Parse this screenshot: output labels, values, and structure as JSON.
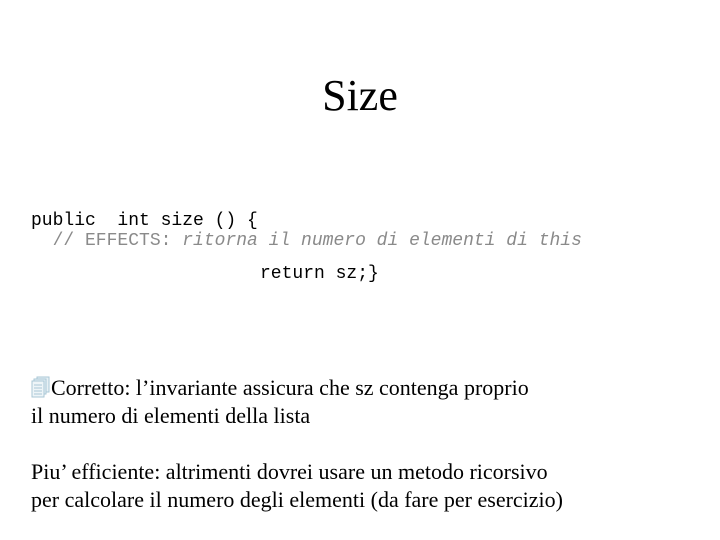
{
  "slide": {
    "title": "Size",
    "code": {
      "line1": "public  int size () {",
      "line2_prefix": "  // EFFECTS: ",
      "line2_italic": "ritorna il numero di elementi di this",
      "line3": "return sz;}"
    },
    "paragraph1": {
      "bullet_icon": "stacked-documents-icon",
      "line1": "Corretto: l’invariante assicura che sz contenga proprio",
      "line2": "il numero di elementi della lista"
    },
    "paragraph2": {
      "line1": "Piu’ efficiente: altrimenti dovrei usare un metodo ricorsivo",
      "line2": "per calcolare il numero degli elementi (da fare per esercizio)"
    },
    "colors": {
      "text": "#000000",
      "comment": "#8a8a8a",
      "bullet": "#a9c7d6"
    }
  }
}
